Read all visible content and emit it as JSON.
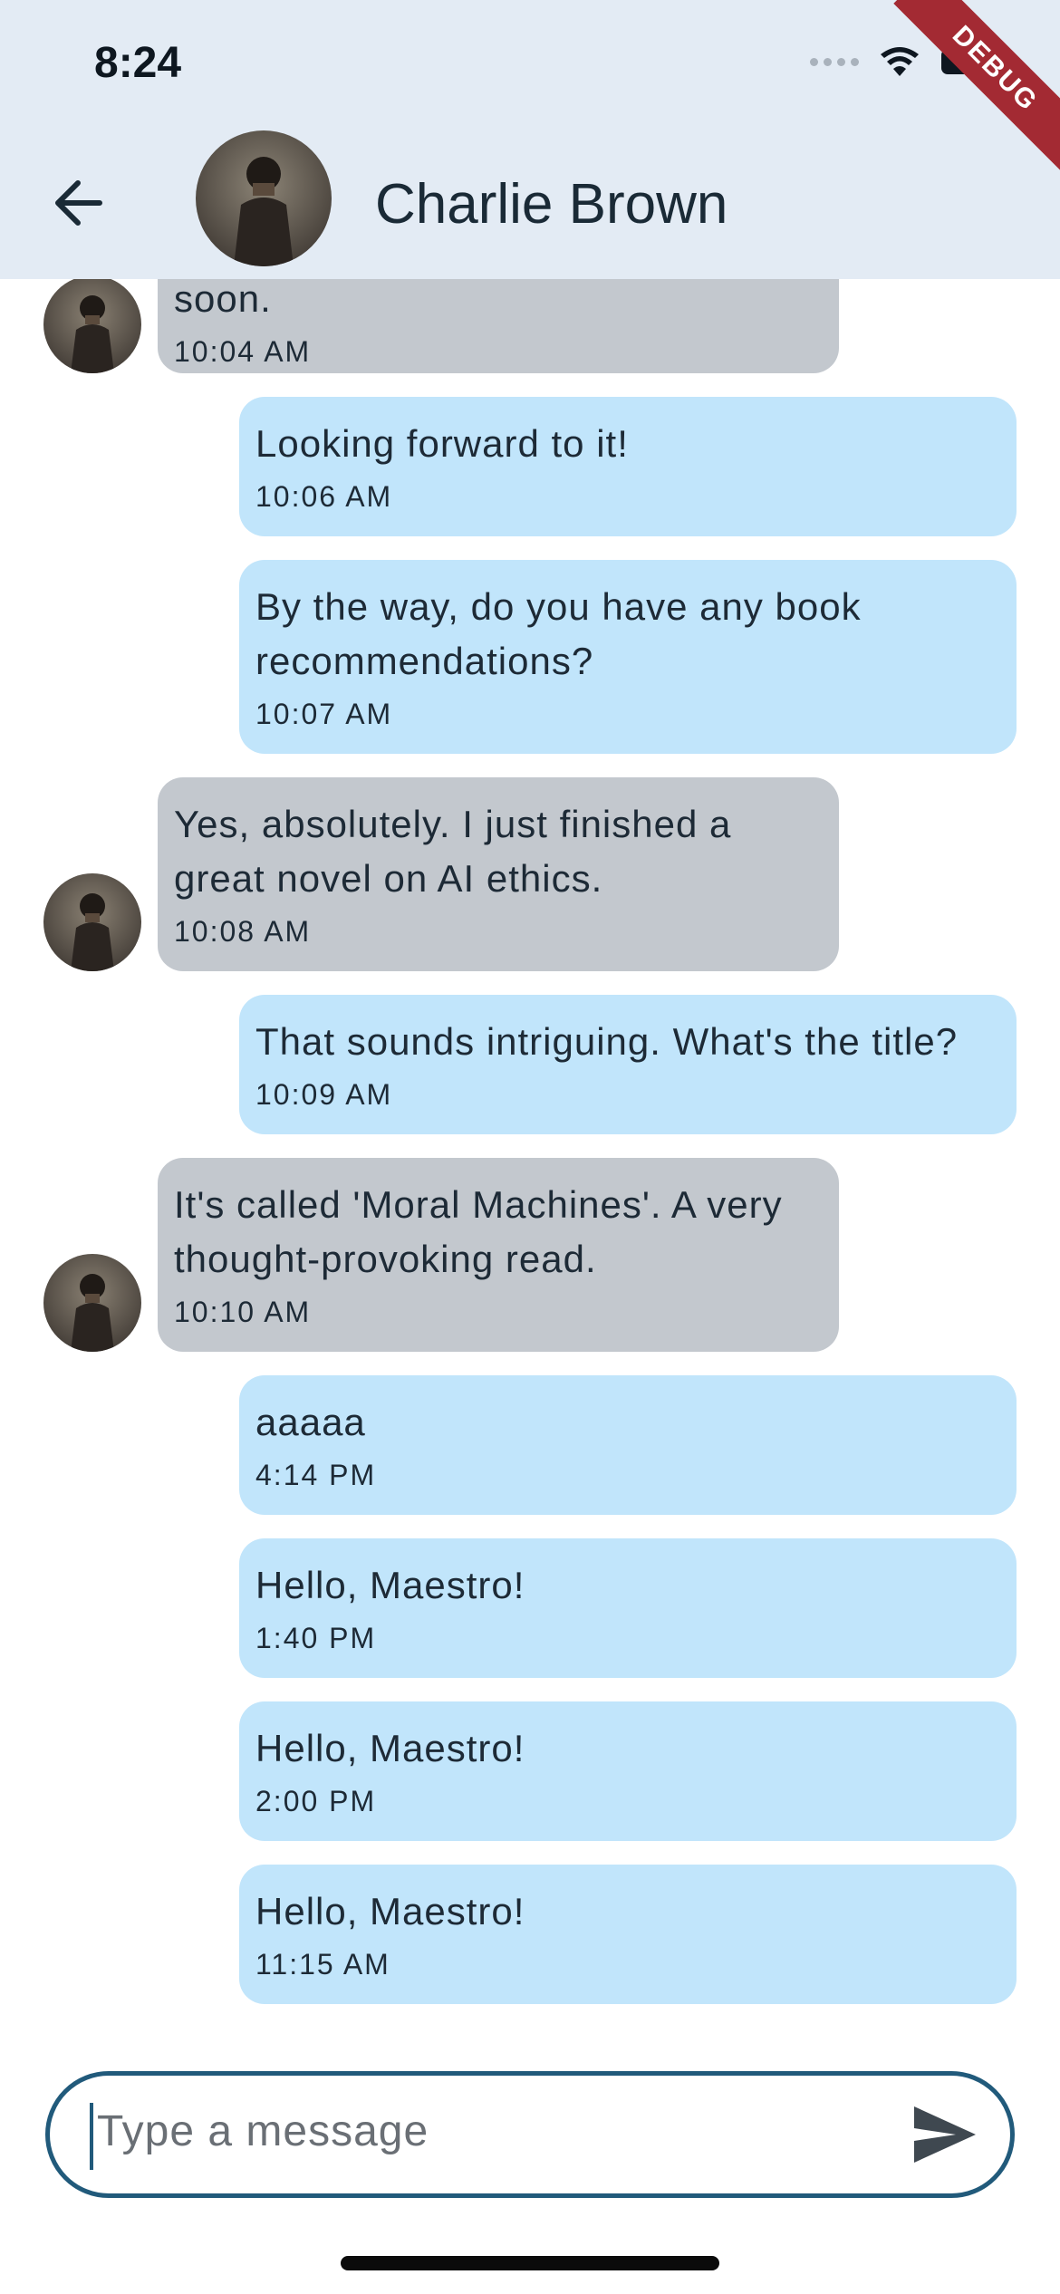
{
  "status_bar": {
    "time": "8:24"
  },
  "debug_banner": "DEBUG",
  "header": {
    "contact_name": "Charlie Brown"
  },
  "messages": [
    {
      "direction": "in",
      "text": "soon.",
      "time": "10:04 AM"
    },
    {
      "direction": "out",
      "text": "Looking forward to it!",
      "time": "10:06 AM"
    },
    {
      "direction": "out",
      "text": "By the way, do you have any book recommendations?",
      "time": "10:07 AM"
    },
    {
      "direction": "in",
      "text": "Yes, absolutely. I just finished a great novel on AI ethics.",
      "time": "10:08 AM"
    },
    {
      "direction": "out",
      "text": "That sounds intriguing. What's the title?",
      "time": "10:09 AM"
    },
    {
      "direction": "in",
      "text": "It's called 'Moral Machines'. A very thought-provoking read.",
      "time": "10:10 AM"
    },
    {
      "direction": "out",
      "text": "aaaaa",
      "time": "4:14 PM"
    },
    {
      "direction": "out",
      "text": "Hello, Maestro!",
      "time": "1:40 PM"
    },
    {
      "direction": "out",
      "text": "Hello, Maestro!",
      "time": "2:00 PM"
    },
    {
      "direction": "out",
      "text": "Hello, Maestro!",
      "time": "11:15 AM"
    }
  ],
  "composer": {
    "placeholder": "Type a message"
  },
  "colors": {
    "incoming_bubble": "#c3c8ce",
    "outgoing_bubble": "#c1e5fb",
    "app_bar": "#e3ebf4",
    "input_border": "#215a7b",
    "debug_ribbon": "#a32a33"
  },
  "icons": {
    "back": "arrow-left-icon",
    "send": "send-icon",
    "wifi": "wifi-icon",
    "battery": "battery-icon",
    "signal": "cellular-signal-icon"
  }
}
